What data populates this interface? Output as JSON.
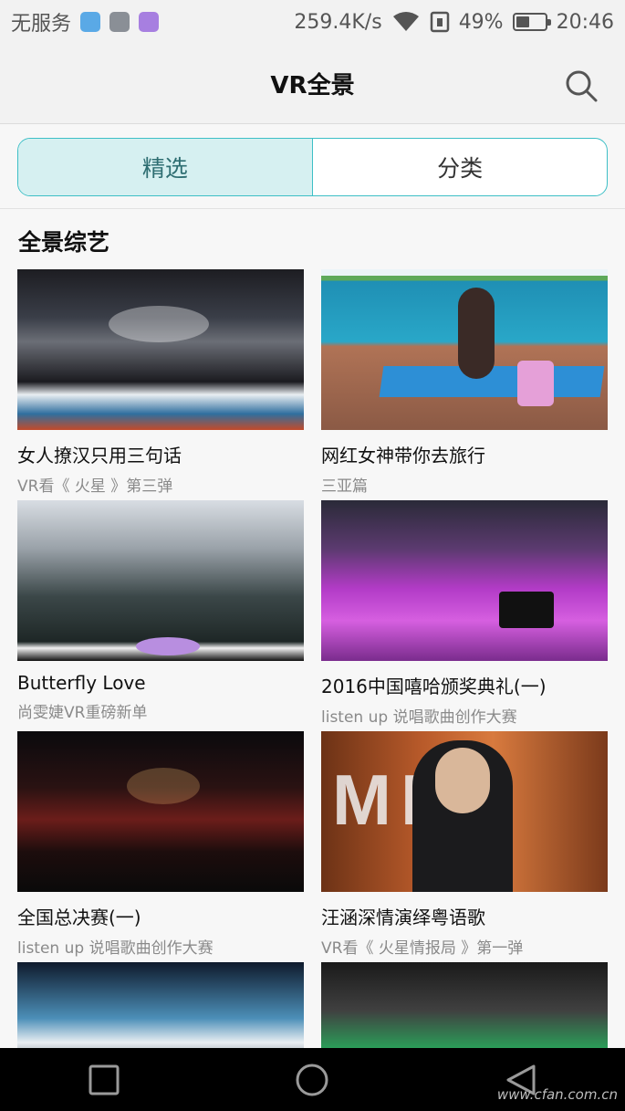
{
  "status_bar": {
    "carrier": "无服务",
    "speed": "259.4K/s",
    "battery_percent": "49%",
    "battery_level": 0.49,
    "time": "20:46",
    "icons": [
      "health-icon",
      "gallery-icon",
      "keyboard-icon",
      "wifi-icon",
      "sim-icon",
      "battery-icon"
    ]
  },
  "app_bar": {
    "title": "VR全景",
    "search_icon": "search-icon"
  },
  "tabs": [
    {
      "label": "精选",
      "active": true
    },
    {
      "label": "分类",
      "active": false
    }
  ],
  "section": {
    "title": "全景综艺"
  },
  "items": [
    {
      "title": "女人撩汉只用三句话",
      "subtitle": "VR看《 火星 》第三弹"
    },
    {
      "title": "网红女神带你去旅行",
      "subtitle": "三亚篇"
    },
    {
      "title": "Butterfly Love",
      "subtitle": "尚雯婕VR重磅新单"
    },
    {
      "title": "2016中国嘻哈颁奖典礼(一)",
      "subtitle": "listen up 说唱歌曲创作大赛"
    },
    {
      "title": "全国总决赛(一)",
      "subtitle": "listen up 说唱歌曲创作大赛"
    },
    {
      "title": "汪涵深情演绎粤语歌",
      "subtitle": "VR看《 火星情报局 》第一弹"
    },
    {
      "title": "",
      "subtitle": ""
    },
    {
      "title": "",
      "subtitle": ""
    }
  ],
  "thumb_text": {
    "mia": "MIA"
  },
  "nav_bar": {
    "buttons": [
      "recents-button",
      "home-button",
      "back-button"
    ]
  },
  "watermark": "www.cfan.com.cn"
}
